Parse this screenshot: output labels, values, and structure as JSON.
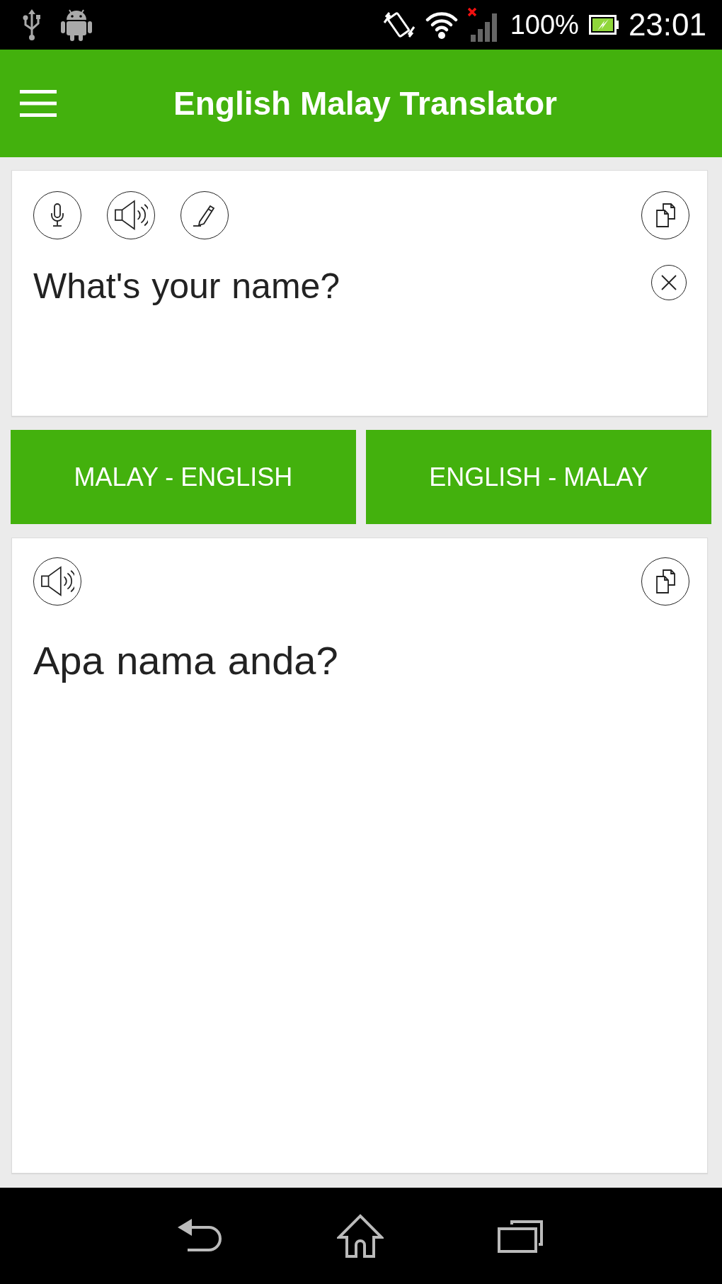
{
  "status_bar": {
    "battery": "100%",
    "time": "23:01"
  },
  "app_bar": {
    "title": "English Malay Translator"
  },
  "input_card": {
    "text": "What's your name?"
  },
  "direction_buttons": [
    {
      "label": "MALAY - ENGLISH"
    },
    {
      "label": "ENGLISH - MALAY"
    }
  ],
  "output_card": {
    "text": "Apa nama anda?"
  }
}
